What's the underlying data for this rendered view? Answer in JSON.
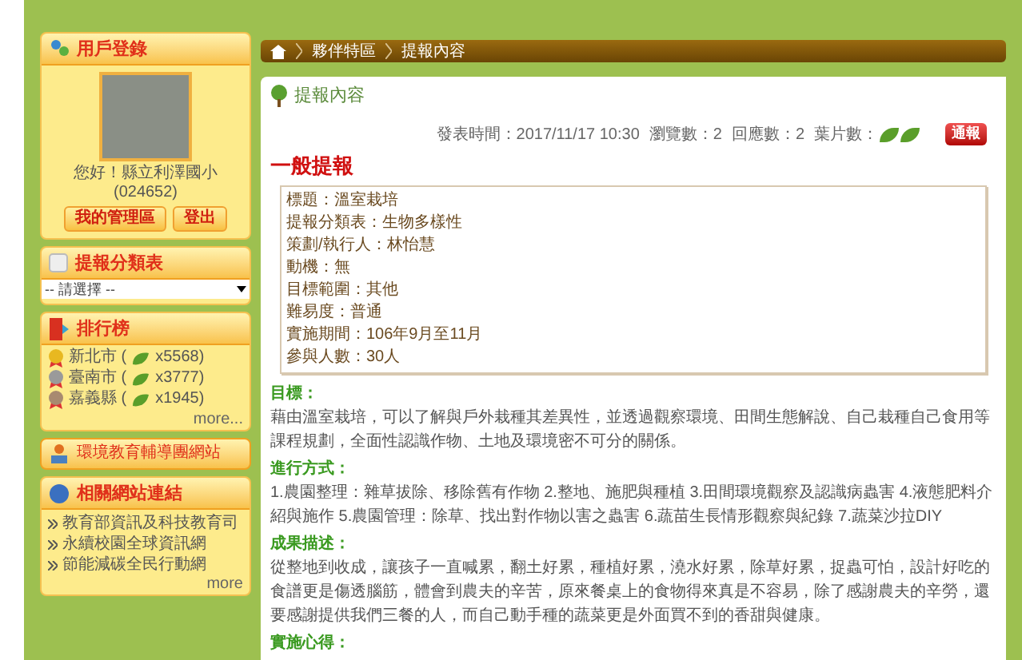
{
  "login": {
    "title": "用戶登錄",
    "greeting": "您好！縣立利澤國小",
    "user_id": "(024652)",
    "buttons": [
      "我的管理區",
      "登出"
    ]
  },
  "category": {
    "title": "提報分類表",
    "select_value": "-- 請選擇 --"
  },
  "ranking": {
    "title": "排行榜",
    "items": [
      {
        "name": "新北市 (",
        "count": "x5568)",
        "color": "#e8b820"
      },
      {
        "name": "臺南市 (",
        "count": "x3777)",
        "color": "#9a9a9a"
      },
      {
        "name": "嘉義縣 (",
        "count": "x1945)",
        "color": "#a88a70"
      }
    ],
    "more": "more..."
  },
  "banner": "環境教育輔導團網站",
  "links": {
    "title": "相關網站連結",
    "items": [
      "教育部資訊及科技教育司",
      "永續校園全球資訊網",
      "節能減碳全民行動網"
    ],
    "more": "more"
  },
  "breadcrumb": [
    "夥伴特區",
    "提報內容"
  ],
  "panel_title": "提報內容",
  "meta": {
    "time": "發表時間：2017/11/17 10:30",
    "views": "瀏覽數：2",
    "replies": "回應數：2",
    "leaves_label": "葉片數：",
    "leaves": [
      {
        "kind": "leaf"
      },
      {
        "kind": "leaf"
      }
    ],
    "report_button": "通報"
  },
  "heading": "一般提報",
  "info": [
    "標題：溫室栽培",
    "提報分類表：生物多樣性",
    "策劃/執行人：林怡慧",
    "動機：無",
    "目標範圍：其他",
    "難易度：普通",
    "實施期間：106年9月至11月",
    "參與人數：30人"
  ],
  "sections": [
    {
      "title": "目標：",
      "body": "藉由溫室栽培，可以了解與戶外栽種其差異性，並透過觀察環境、田間生態解說、自己栽種自己食用等課程規劃，全面性認識作物、土地及環境密不可分的關係。"
    },
    {
      "title": "進行方式：",
      "body": "1.農園整理：雜草拔除、移除舊有作物 2.整地、施肥與種植 3.田間環境觀察及認識病蟲害 4.液態肥料介紹與施作 5.農園管理：除草、找出對作物以害之蟲害 6.蔬苗生長情形觀察與紀錄 7.蔬菜沙拉DIY"
    },
    {
      "title": "成果描述：",
      "body": "從整地到收成，讓孩子一直喊累，翻土好累，種植好累，澆水好累，除草好累，捉蟲可怕，設計好吃的食譜更是傷透腦筋，體會到農夫的辛苦，原來餐桌上的食物得來真是不容易，除了感謝農夫的辛勞，還要感謝提供我們三餐的人，而自己動手種的蔬菜更是外面買不到的香甜與健康。"
    },
    {
      "title": "實施心得："
    }
  ]
}
